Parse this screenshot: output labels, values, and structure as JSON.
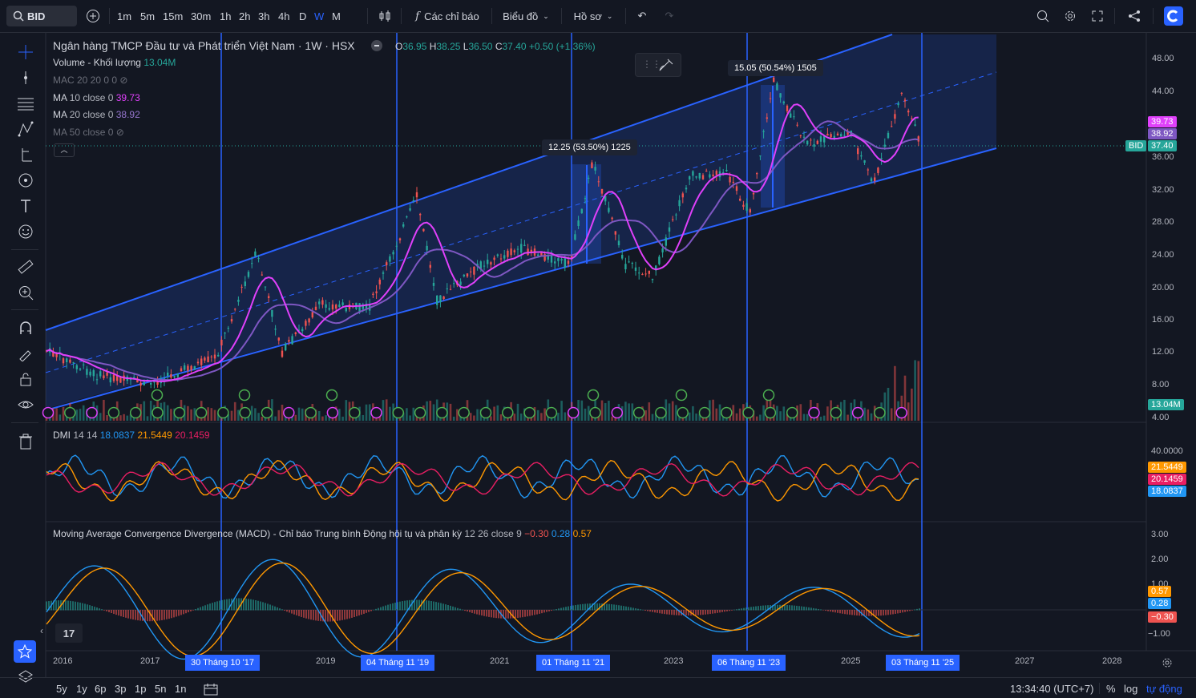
{
  "toolbar": {
    "symbol": "BID",
    "intervals": [
      "1m",
      "5m",
      "15m",
      "30m",
      "1h",
      "2h",
      "3h",
      "4h",
      "D",
      "W",
      "M"
    ],
    "active_interval": "W",
    "indicators_label": "Các chỉ báo",
    "chart_type_label": "Biểu đồ",
    "profile_label": "Hồ sơ"
  },
  "legend": {
    "title": "Ngân hàng TMCP Đầu tư và Phát triển Việt Nam · 1W · HSX",
    "ohlc": {
      "o_label": "O",
      "o": "36.95",
      "h_label": "H",
      "h": "38.25",
      "l_label": "L",
      "l": "36.50",
      "c_label": "C",
      "c": "37.40",
      "change": "+0.50 (+1.36%)"
    },
    "volume": {
      "name": "Volume - Khối lượng",
      "value": "13.04M"
    },
    "ma_vol": {
      "name": "MAC 20 20 0 0"
    },
    "ma10": {
      "name": "MA",
      "params": "10 close 0",
      "value": "39.73"
    },
    "ma20": {
      "name": "MA",
      "params": "20 close 0",
      "value": "38.92"
    },
    "ma50": {
      "name": "MA 50 close 0"
    }
  },
  "measures": [
    {
      "label": "12.25 (53.50%) 1225"
    },
    {
      "label": "15.05 (50.54%) 1505"
    }
  ],
  "price_axis": [
    "48.00",
    "44.00",
    "40.00",
    "36.00",
    "32.00",
    "28.00",
    "24.00",
    "20.00",
    "16.00",
    "12.00",
    "8.00",
    "4.00"
  ],
  "price_tags": {
    "ma10": "39.73",
    "ma20": "38.92",
    "symbol": "BID",
    "last": "37.40",
    "volume": "13.04M"
  },
  "dmi": {
    "name": "DMI",
    "params": "14 14",
    "v1": "18.0837",
    "v2": "21.5449",
    "v3": "20.1459",
    "axis": "40.0000"
  },
  "macd": {
    "name": "Moving Average Convergence Divergence (MACD) - Chỉ báo Trung bình Động hội tụ và phân kỳ",
    "params": "12 26 close 9",
    "v1": "−0.30",
    "v2": "0.28",
    "v3": "0.57",
    "axis": [
      "3.00",
      "2.00",
      "1.00",
      "−1.00"
    ]
  },
  "time_axis": [
    "2016",
    "2017",
    "2019",
    "2021",
    "2023",
    "2025",
    "2027",
    "2028"
  ],
  "time_highlights": [
    "30 Tháng 10 '17",
    "04 Tháng 11 '19",
    "01 Tháng 11 '21",
    "06 Tháng 11 '23",
    "03 Tháng 11 '25"
  ],
  "bottom": {
    "ranges": [
      "5y",
      "1y",
      "6p",
      "3p",
      "1p",
      "5n",
      "1n"
    ],
    "clock": "13:34:40 (UTC+7)",
    "pct": "%",
    "log": "log",
    "auto": "tự động"
  },
  "colors": {
    "bg": "#131722",
    "up": "#26a69a",
    "down": "#ef5350",
    "ma10": "#e040fb",
    "ma20": "#7e57c2",
    "channel": "#2962ff",
    "dmi_blue": "#2196f3",
    "dmi_orange": "#ff9800",
    "dmi_red": "#e91e63"
  }
}
